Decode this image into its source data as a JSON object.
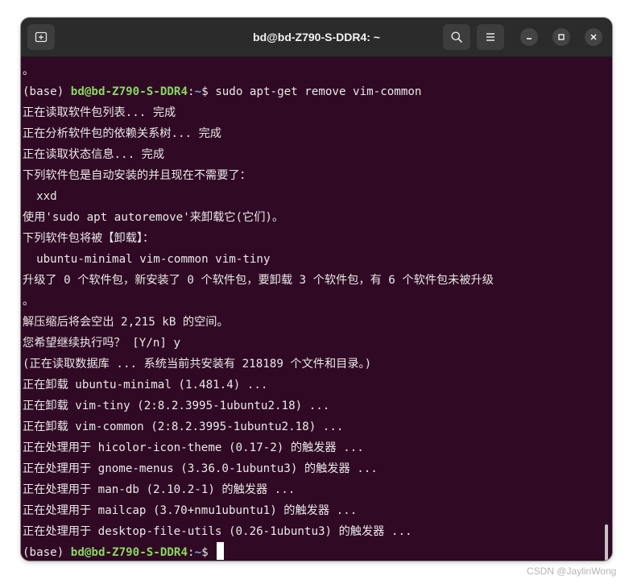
{
  "window": {
    "title": "bd@bd-Z790-S-DDR4: ~",
    "icons": {
      "new_tab": "new-tab-icon",
      "search": "search-icon",
      "menu": "hamburger-menu-icon",
      "minimize": "minimize-icon",
      "maximize": "maximize-icon",
      "close": "close-icon"
    }
  },
  "colors": {
    "terminal_bg": "#300a24",
    "titlebar_bg": "#2b2b2b",
    "prompt_user": "#87d75f",
    "prompt_path": "#6fa8dc",
    "text": "#e8e8e8"
  },
  "prompt": {
    "env": "(base) ",
    "user_host": "bd@bd-Z790-S-DDR4",
    "colon": ":",
    "path": "~",
    "symbol": "$ "
  },
  "first_command": "sudo apt-get remove vim-common",
  "output_top": "。",
  "output": [
    "正在读取软件包列表... 完成",
    "正在分析软件包的依赖关系树... 完成",
    "正在读取状态信息... 完成",
    "下列软件包是自动安装的并且现在不需要了：",
    "  xxd",
    "使用'sudo apt autoremove'来卸载它(它们)。",
    "下列软件包将被【卸载】：",
    "  ubuntu-minimal vim-common vim-tiny",
    "升级了 0 个软件包，新安装了 0 个软件包，要卸载 3 个软件包，有 6 个软件包未被升级",
    "。",
    "解压缩后将会空出 2,215 kB 的空间。",
    "您希望继续执行吗？ [Y/n] y",
    "(正在读取数据库 ... 系统当前共安装有 218189 个文件和目录。)",
    "正在卸载 ubuntu-minimal (1.481.4) ...",
    "正在卸载 vim-tiny (2:8.2.3995-1ubuntu2.18) ...",
    "正在卸载 vim-common (2:8.2.3995-1ubuntu2.18) ...",
    "正在处理用于 hicolor-icon-theme (0.17-2) 的触发器 ...",
    "正在处理用于 gnome-menus (3.36.0-1ubuntu3) 的触发器 ...",
    "正在处理用于 man-db (2.10.2-1) 的触发器 ...",
    "正在处理用于 mailcap (3.70+nmu1ubuntu1) 的触发器 ...",
    "正在处理用于 desktop-file-utils (0.26-1ubuntu3) 的触发器 ..."
  ],
  "watermark": "CSDN @JaylinWong"
}
